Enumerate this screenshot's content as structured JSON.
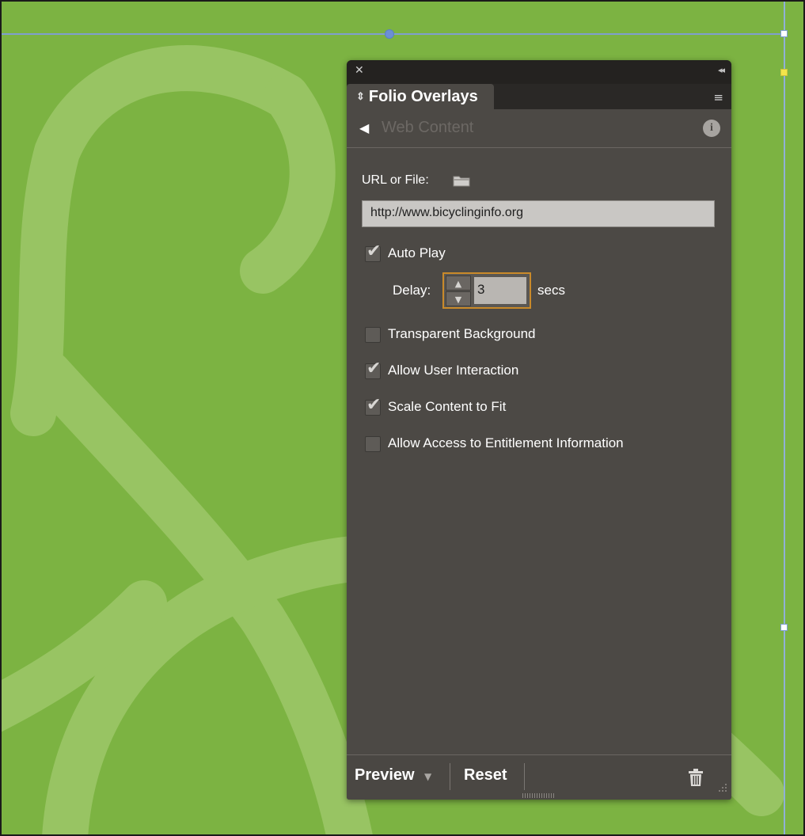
{
  "panel": {
    "tab_title": "Folio Overlays",
    "subheader_title": "Web Content",
    "url_label": "URL or File:",
    "url_value": "http://www.bicyclinginfo.org",
    "options": [
      {
        "label": "Auto Play",
        "checked": true
      },
      {
        "label": "Transparent Background",
        "checked": false
      },
      {
        "label": "Allow User Interaction",
        "checked": true
      },
      {
        "label": "Scale Content to Fit",
        "checked": true
      },
      {
        "label": "Allow Access to Entitlement Information",
        "checked": false
      }
    ],
    "delay": {
      "label": "Delay:",
      "value": "3",
      "unit": "secs"
    },
    "footer": {
      "preview_label": "Preview",
      "reset_label": "Reset"
    }
  },
  "icons": {
    "close": "✕",
    "collapse": "◂◂",
    "tab_updown": "⇕",
    "panel_menu": "≡",
    "back": "◀",
    "info": "i",
    "stepper_up": "▲",
    "stepper_down": "▼",
    "dropdown": "▼"
  },
  "colors": {
    "page_background": "#7cb342",
    "pattern_stroke": "#98c463",
    "panel_background": "#4c4945",
    "accent_focus": "#c98a2a"
  }
}
